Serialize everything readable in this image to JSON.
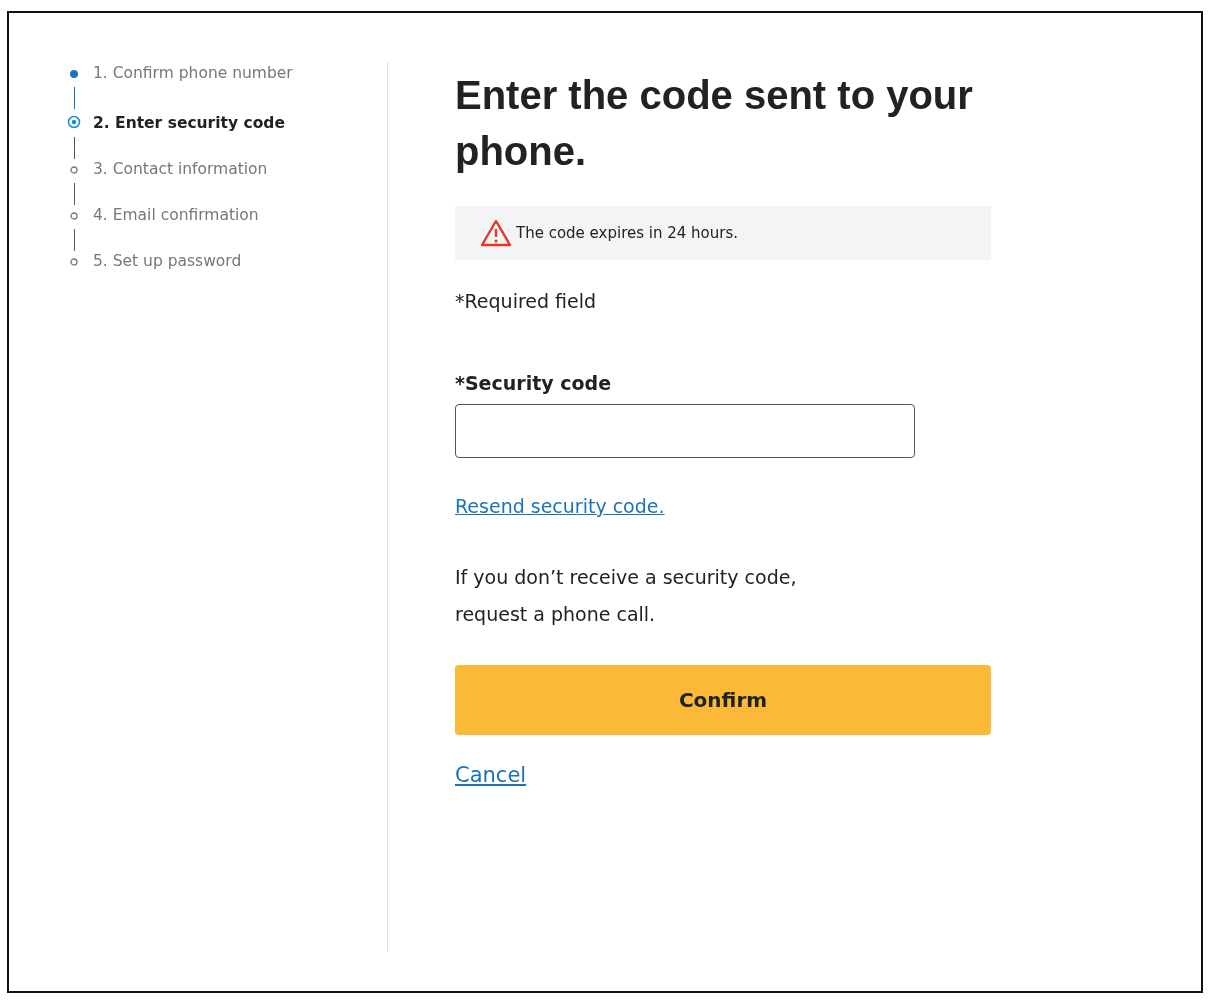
{
  "steps": [
    {
      "label": "1. Confirm phone number",
      "kind": "done",
      "selected": false
    },
    {
      "label": "2. Enter security code",
      "kind": "current",
      "selected": true
    },
    {
      "label": "3. Contact information",
      "kind": "todo",
      "selected": false
    },
    {
      "label": "4. Email confirmation",
      "kind": "todo",
      "selected": false
    },
    {
      "label": "5. Set up password",
      "kind": "todo",
      "selected": false
    }
  ],
  "heading": "Enter the code sent to your phone.",
  "notice": "The code expires in 24 hours.",
  "required_note": "*Required field",
  "security_code": {
    "label": "*Security code"
  },
  "resend_link": "Resend security code.",
  "help_text": "If you don’t receive a security code, request a phone call.",
  "confirm_button": "Confirm",
  "cancel_link": "Cancel"
}
